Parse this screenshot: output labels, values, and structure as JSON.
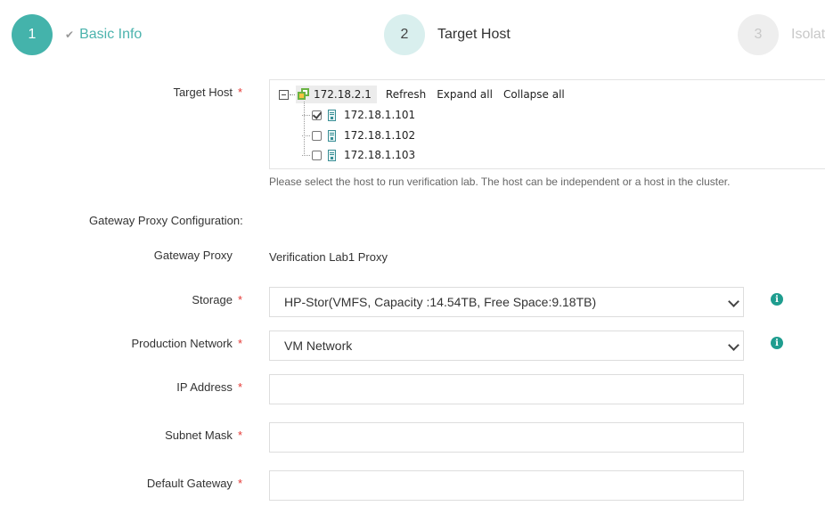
{
  "wizard": {
    "steps": [
      {
        "number": "1",
        "label": "Basic Info",
        "state": "completed",
        "check_icon": "checkmark-icon"
      },
      {
        "number": "2",
        "label": "Target Host",
        "state": "active"
      },
      {
        "number": "3",
        "label": "Isolat",
        "state": "pending"
      }
    ],
    "colors": {
      "completed": "#44b3ab",
      "active_bg": "#d9efee",
      "pending_bg": "#eeeeee"
    }
  },
  "form": {
    "target_host": {
      "label": "Target Host",
      "required_mark": "*",
      "tree": {
        "root": {
          "label": "172.18.2.1",
          "icon": "vcenter-icon",
          "expanded": true
        },
        "actions": {
          "refresh": "Refresh",
          "expand_all": "Expand all",
          "collapse_all": "Collapse all"
        },
        "children": [
          {
            "label": "172.18.1.101",
            "checked": true,
            "icon": "host-icon"
          },
          {
            "label": "172.18.1.102",
            "checked": false,
            "icon": "host-icon"
          },
          {
            "label": "172.18.1.103",
            "checked": false,
            "icon": "host-icon"
          }
        ]
      },
      "hint": "Please select the host to run verification lab. The host can be independent or a host in the cluster."
    },
    "gateway_section_title": "Gateway Proxy Configuration:",
    "gateway_proxy": {
      "label": "Gateway Proxy",
      "value": "Verification Lab1 Proxy"
    },
    "storage": {
      "label": "Storage",
      "required_mark": "*",
      "value": "HP-Stor(VMFS, Capacity :14.54TB, Free Space:9.18TB)"
    },
    "production_network": {
      "label": "Production Network",
      "required_mark": "*",
      "value": "VM Network"
    },
    "ip_address": {
      "label": "IP Address",
      "required_mark": "*",
      "value": ""
    },
    "subnet_mask": {
      "label": "Subnet Mask",
      "required_mark": "*",
      "value": ""
    },
    "default_gateway": {
      "label": "Default Gateway",
      "required_mark": "*",
      "value": ""
    }
  }
}
